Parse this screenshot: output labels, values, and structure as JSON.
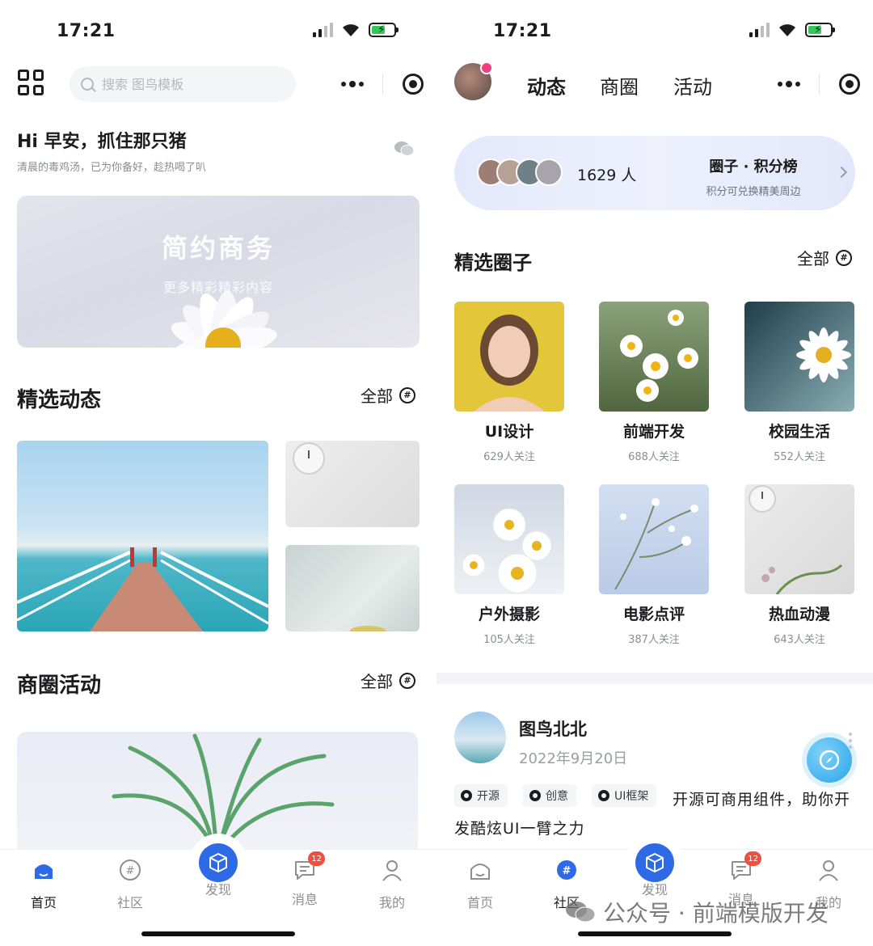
{
  "left": {
    "status": {
      "time": "17:21"
    },
    "search": {
      "placeholder": "搜索 图鸟模板"
    },
    "greeting": {
      "title": "Hi 早安，抓住那只猪",
      "subtitle": "清晨的毒鸡汤，已为你备好，趁热喝了叭"
    },
    "banner": {
      "title": "简约商务",
      "subtitle": "更多精彩精彩内容"
    },
    "featured": {
      "title": "精选动态",
      "more": "全部"
    },
    "activities": {
      "title": "商圈活动",
      "more": "全部"
    },
    "tabs": [
      {
        "label": "首页",
        "icon": "home-icon"
      },
      {
        "label": "社区",
        "icon": "community-icon"
      },
      {
        "label": "发现",
        "icon": "cube-icon"
      },
      {
        "label": "消息",
        "icon": "message-icon",
        "badge": "12"
      },
      {
        "label": "我的",
        "icon": "profile-icon"
      }
    ]
  },
  "right": {
    "status": {
      "time": "17:21"
    },
    "top_tabs": [
      "动态",
      "商圈",
      "活动"
    ],
    "rank": {
      "count": "1629 人",
      "title": "圈子 · 积分榜",
      "subtitle": "积分可兑换精美周边"
    },
    "circles_section": {
      "title": "精选圈子",
      "more": "全部"
    },
    "circles": [
      {
        "name": "UI设计",
        "followers": "629人关注"
      },
      {
        "name": "前端开发",
        "followers": "688人关注"
      },
      {
        "name": "校园生活",
        "followers": "552人关注"
      },
      {
        "name": "户外摄影",
        "followers": "105人关注"
      },
      {
        "name": "电影点评",
        "followers": "387人关注"
      },
      {
        "name": "热血动漫",
        "followers": "643人关注"
      }
    ],
    "post": {
      "author": "图鸟北北",
      "date": "2022年9月20日",
      "tags": [
        "开源",
        "创意",
        "UI框架"
      ],
      "text_line1": "开源可商用组件，助你开",
      "text_line2": "发酷炫UI一臂之力"
    },
    "tabs": [
      {
        "label": "首页",
        "icon": "home-icon"
      },
      {
        "label": "社区",
        "icon": "community-icon"
      },
      {
        "label": "发现",
        "icon": "cube-icon"
      },
      {
        "label": "消息",
        "icon": "message-icon",
        "badge": "12"
      },
      {
        "label": "我的",
        "icon": "profile-icon"
      }
    ]
  },
  "watermark": "公众号 · 前端模版开发",
  "colors": {
    "accent": "#2f6ae6",
    "badge": "#f24e3e",
    "battery": "#34c759"
  }
}
